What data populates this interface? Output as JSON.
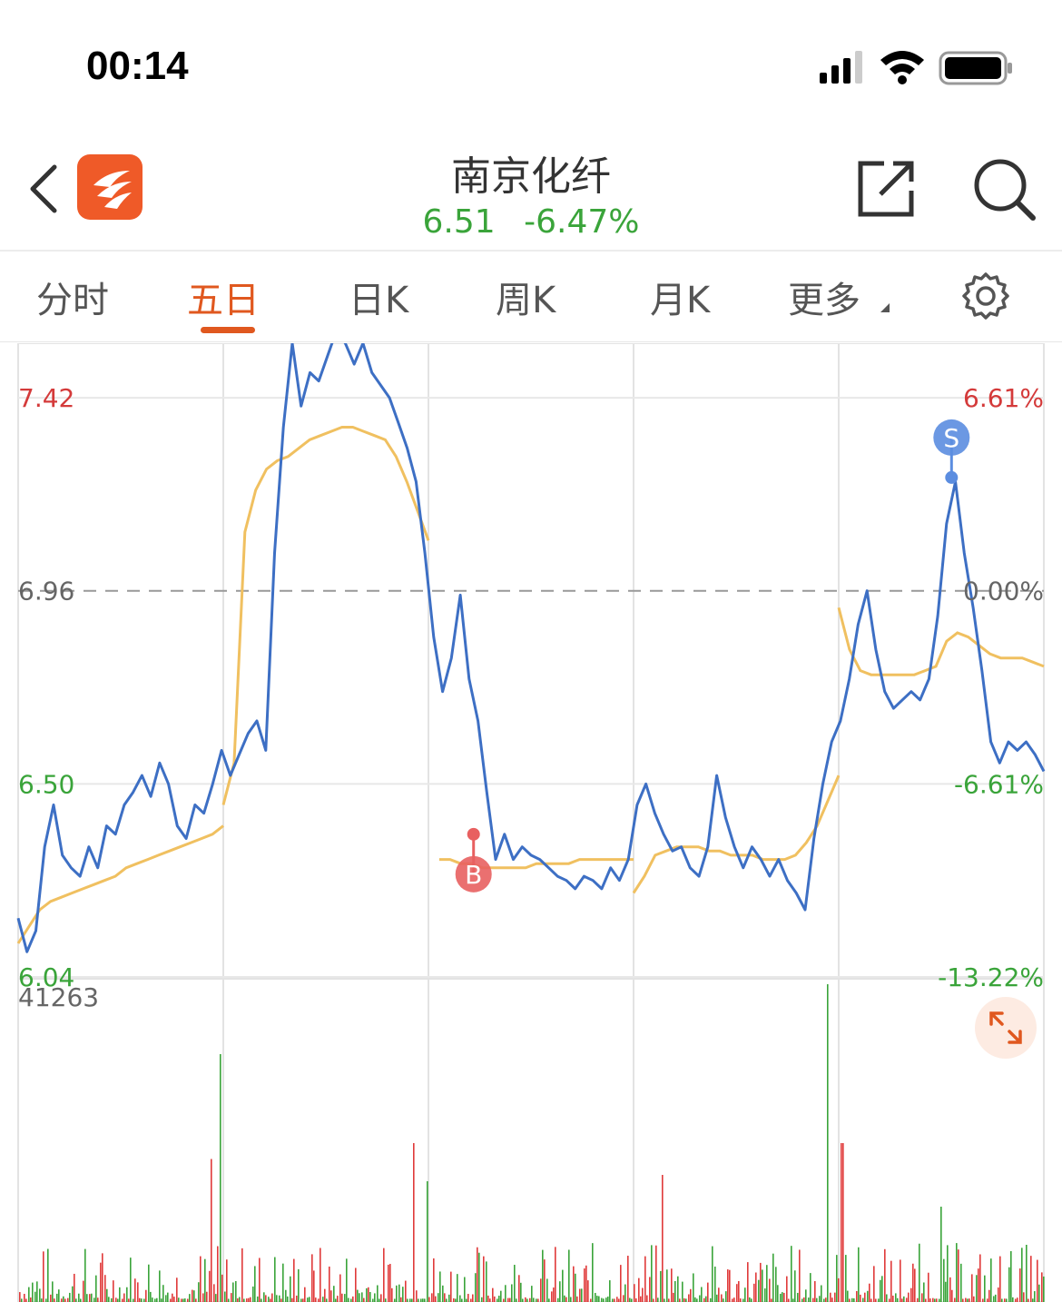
{
  "status_bar": {
    "time": "00:14"
  },
  "header": {
    "title": "南京化纤",
    "price": "6.51",
    "change_pct": "-6.47%"
  },
  "tabs": [
    {
      "label": "分时",
      "active": false
    },
    {
      "label": "五日",
      "active": true
    },
    {
      "label": "日K",
      "active": false
    },
    {
      "label": "周K",
      "active": false
    },
    {
      "label": "月K",
      "active": false
    },
    {
      "label": "更多",
      "active": false
    }
  ],
  "colors": {
    "accent": "#e0581f",
    "up": "#e03a3a",
    "down": "#3aa43a",
    "price_line": "#3d6fc4",
    "avg_line": "#f0c060"
  },
  "chart_data": {
    "type": "line",
    "days": 5,
    "price_axis": {
      "ylim": [
        6.04,
        7.55
      ],
      "ticks": [
        "7.42",
        "6.96",
        "6.50",
        "6.04"
      ],
      "reference": 6.96
    },
    "pct_axis": {
      "ticks": [
        "6.61%",
        "0.00%",
        "-6.61%",
        "-13.22%"
      ]
    },
    "series": [
      {
        "name": "price",
        "values": [
          6.18,
          6.1,
          6.15,
          6.35,
          6.45,
          6.33,
          6.3,
          6.28,
          6.35,
          6.3,
          6.4,
          6.38,
          6.45,
          6.48,
          6.52,
          6.47,
          6.55,
          6.5,
          6.4,
          6.37,
          6.45,
          6.43,
          6.5,
          6.58,
          6.52,
          6.57,
          6.62,
          6.65,
          6.58,
          7.05,
          7.35,
          7.55,
          7.4,
          7.48,
          7.46,
          7.52,
          7.58,
          7.55,
          7.5,
          7.55,
          7.48,
          7.45,
          7.42,
          7.36,
          7.3,
          7.22,
          7.05,
          6.85,
          6.72,
          6.8,
          6.95,
          6.75,
          6.65,
          6.48,
          6.32,
          6.38,
          6.32,
          6.35,
          6.33,
          6.32,
          6.3,
          6.28,
          6.27,
          6.25,
          6.28,
          6.27,
          6.25,
          6.3,
          6.27,
          6.32,
          6.45,
          6.5,
          6.43,
          6.38,
          6.34,
          6.35,
          6.3,
          6.28,
          6.35,
          6.52,
          6.42,
          6.35,
          6.3,
          6.35,
          6.32,
          6.28,
          6.32,
          6.27,
          6.24,
          6.2,
          6.37,
          6.5,
          6.6,
          6.65,
          6.75,
          6.88,
          6.96,
          6.82,
          6.72,
          6.68,
          6.7,
          6.72,
          6.7,
          6.75,
          6.9,
          7.12,
          7.22,
          7.05,
          6.92,
          6.77,
          6.6,
          6.55,
          6.6,
          6.58,
          6.6,
          6.57,
          6.53
        ]
      },
      {
        "name": "avg",
        "values": [
          6.12,
          6.16,
          6.2,
          6.22,
          6.23,
          6.24,
          6.25,
          6.26,
          6.27,
          6.28,
          6.3,
          6.31,
          6.32,
          6.33,
          6.34,
          6.35,
          6.36,
          6.37,
          6.38,
          6.4,
          6.45,
          6.55,
          7.1,
          7.2,
          7.25,
          7.27,
          7.28,
          7.3,
          7.32,
          7.33,
          7.34,
          7.35,
          7.35,
          7.34,
          7.33,
          7.32,
          7.28,
          7.22,
          7.15,
          7.08,
          null,
          6.32,
          6.32,
          6.31,
          6.31,
          6.3,
          6.3,
          6.3,
          6.3,
          6.3,
          6.31,
          6.31,
          6.31,
          6.31,
          6.32,
          6.32,
          6.32,
          6.32,
          6.32,
          6.32,
          6.24,
          6.28,
          6.33,
          6.34,
          6.35,
          6.35,
          6.35,
          6.34,
          6.34,
          6.33,
          6.33,
          6.33,
          6.32,
          6.32,
          6.32,
          6.33,
          6.36,
          6.4,
          6.46,
          6.52,
          6.92,
          6.82,
          6.77,
          6.76,
          6.76,
          6.76,
          6.76,
          6.76,
          6.77,
          6.78,
          6.84,
          6.86,
          6.85,
          6.83,
          6.81,
          6.8,
          6.8,
          6.8,
          6.79,
          6.78
        ]
      }
    ],
    "markers": [
      {
        "label": "B",
        "day": 3,
        "value": 6.38,
        "color": "#e86060"
      },
      {
        "label": "S",
        "day": 5,
        "value": 7.23,
        "color": "#5b8de0"
      }
    ],
    "volume": {
      "max_label": "41263",
      "max": 41263
    }
  }
}
